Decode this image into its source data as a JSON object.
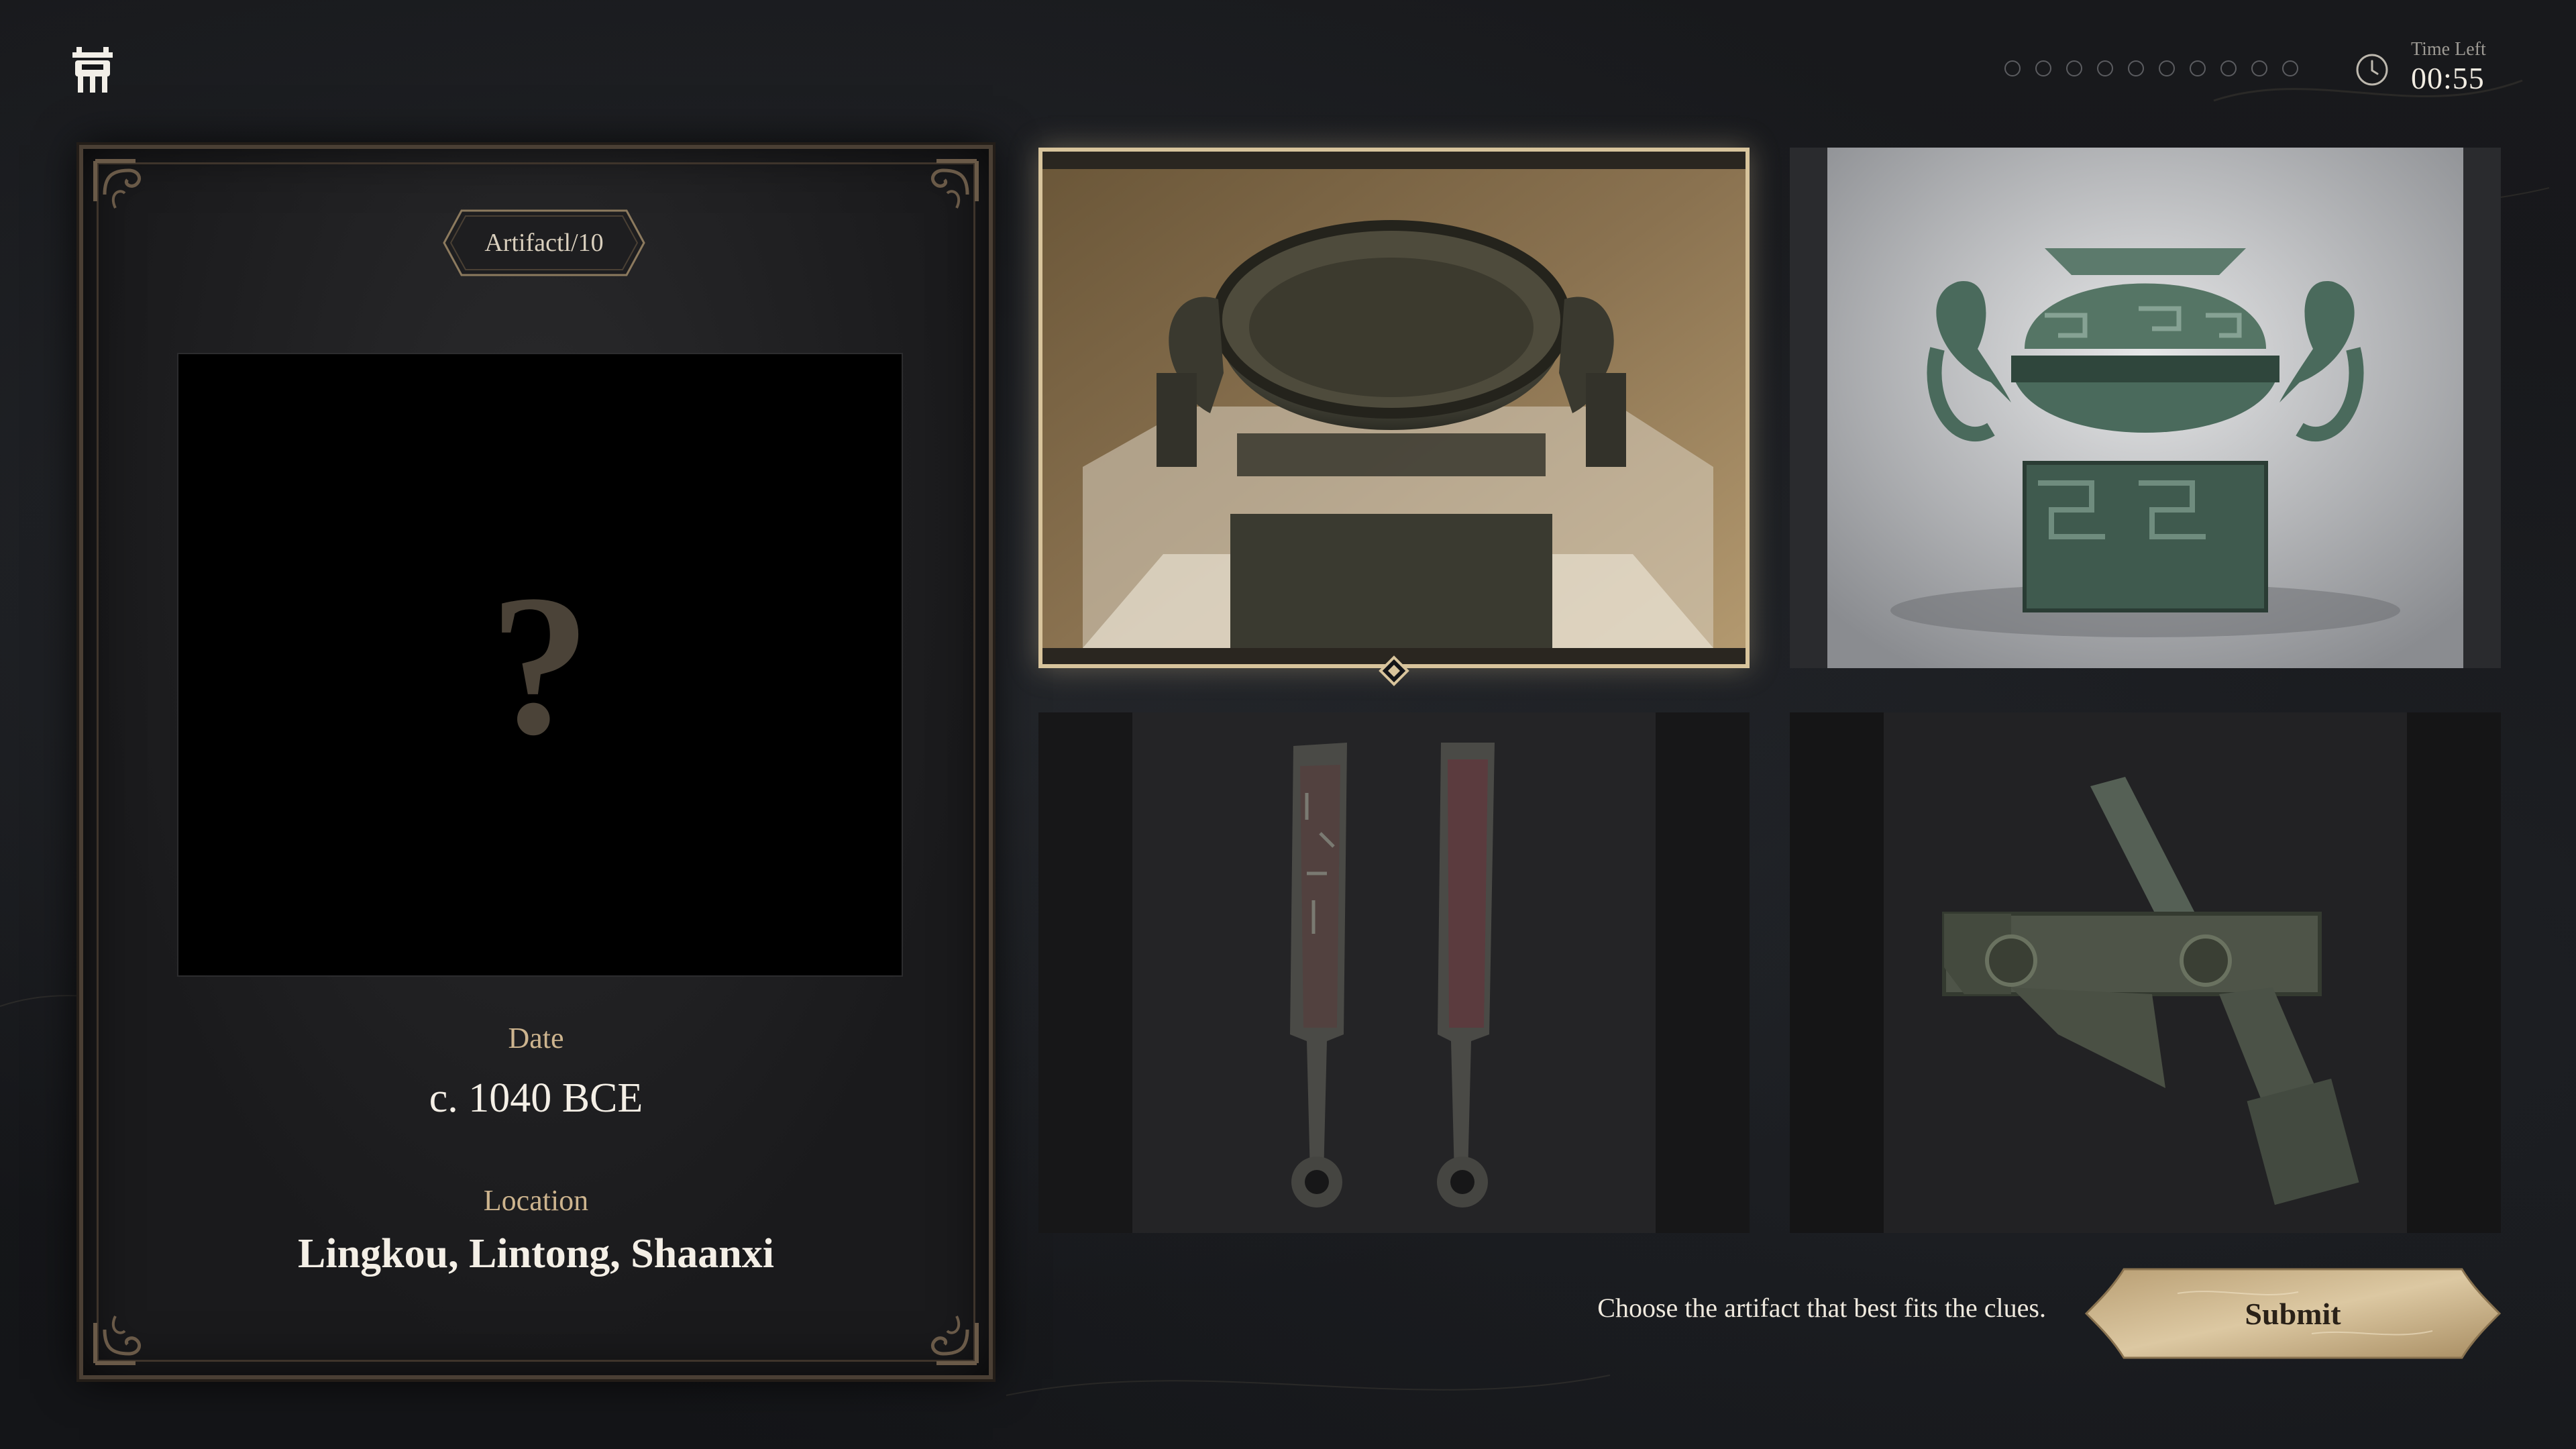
{
  "header": {
    "logo_icon": "bronze-ding-vessel-icon",
    "progress": {
      "total": 10,
      "completed": 0
    },
    "timer": {
      "label": "Time Left",
      "value": "00:55",
      "icon": "clock-icon"
    }
  },
  "clue_card": {
    "counter": "Artifactl/10",
    "mystery_symbol": "?",
    "date_label": "Date",
    "date_value": "c. 1040 BCE",
    "location_label": "Location",
    "location_value": "Lingkou, Lintong, Shaanxi"
  },
  "options": [
    {
      "id": "option-1",
      "subject": "bronze gui vessel with handles in museum case",
      "selected": true
    },
    {
      "id": "option-2",
      "subject": "lidded bronze gui with dragon handles on square base",
      "selected": false
    },
    {
      "id": "option-3",
      "subject": "two bronze knife coins",
      "selected": false
    },
    {
      "id": "option-4",
      "subject": "bronze crossbow trigger mechanism",
      "selected": false
    }
  ],
  "footer": {
    "instruction": "Choose the artifact that best fits the clues.",
    "submit_label": "Submit"
  },
  "colors": {
    "accent_gold": "#d8c49c",
    "background": "#141518",
    "clue_label": "#cdb48e"
  }
}
